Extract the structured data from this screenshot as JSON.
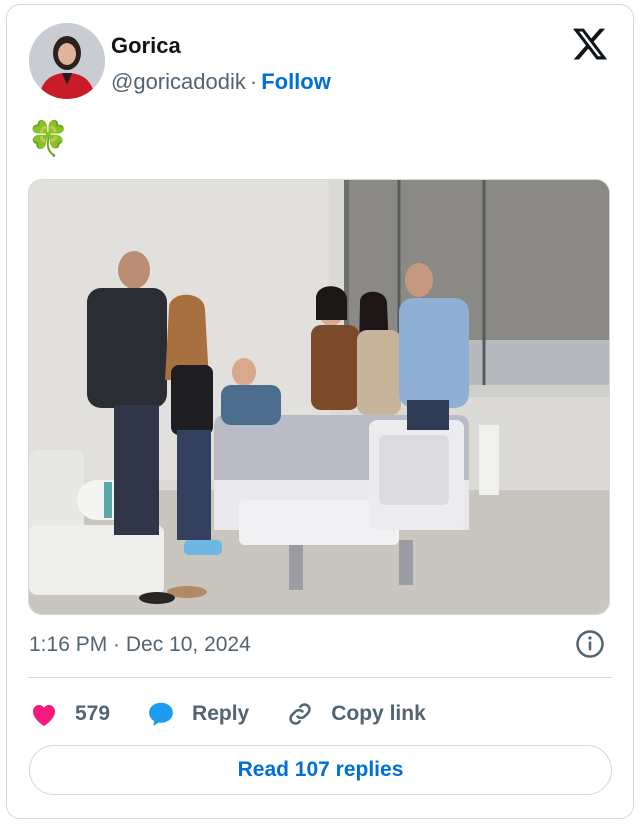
{
  "author": {
    "name": "Gorica",
    "handle": "@goricadodik",
    "separator": "·",
    "follow_label": "Follow",
    "avatar_icon": "profile-photo-avatar"
  },
  "brand_icon": "x-logo-icon",
  "tweet": {
    "text": "🍀",
    "photo_icon": "hospital-room-photo"
  },
  "timestamp": "1:16 PM · Dec 10, 2024",
  "actions": {
    "like_count": "579",
    "reply_label": "Reply",
    "copy_link_label": "Copy link"
  },
  "read_replies_label": "Read 107 replies",
  "colors": {
    "accent": "#006fd6",
    "like": "#f91880",
    "reply": "#1d9bf0",
    "muted": "#536471",
    "border": "#cfd9de"
  }
}
